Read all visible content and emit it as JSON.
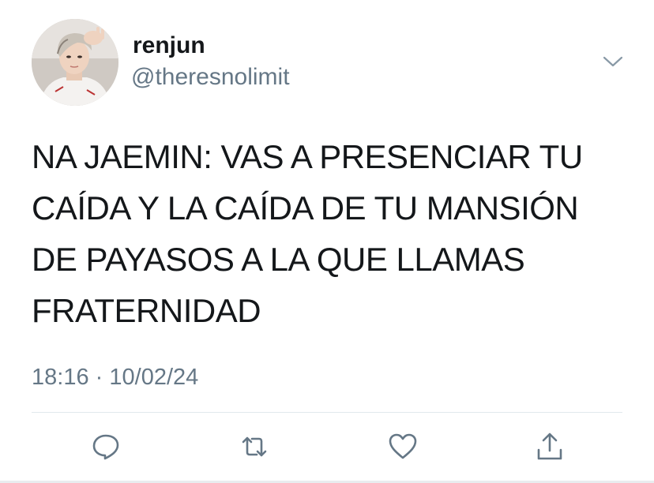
{
  "tweet": {
    "display_name": "renjun",
    "handle": "@theresnolimit",
    "text": "NA JAEMIN: VAS A PRESENCIAR TU\nCAÍDA Y LA CAÍDA DE TU MANSIÓN\nDE PAYASOS A LA QUE LLAMAS\nFRATERNIDAD",
    "time": "18:16",
    "separator": "·",
    "date": "10/02/24"
  },
  "icons": {
    "more": "chevron-down-icon",
    "reply": "reply-icon",
    "retweet": "retweet-icon",
    "like": "heart-icon",
    "share": "share-icon"
  },
  "colors": {
    "text": "#14171a",
    "secondary": "#657786",
    "icon": "#657786",
    "divider": "#e1e8ed"
  }
}
